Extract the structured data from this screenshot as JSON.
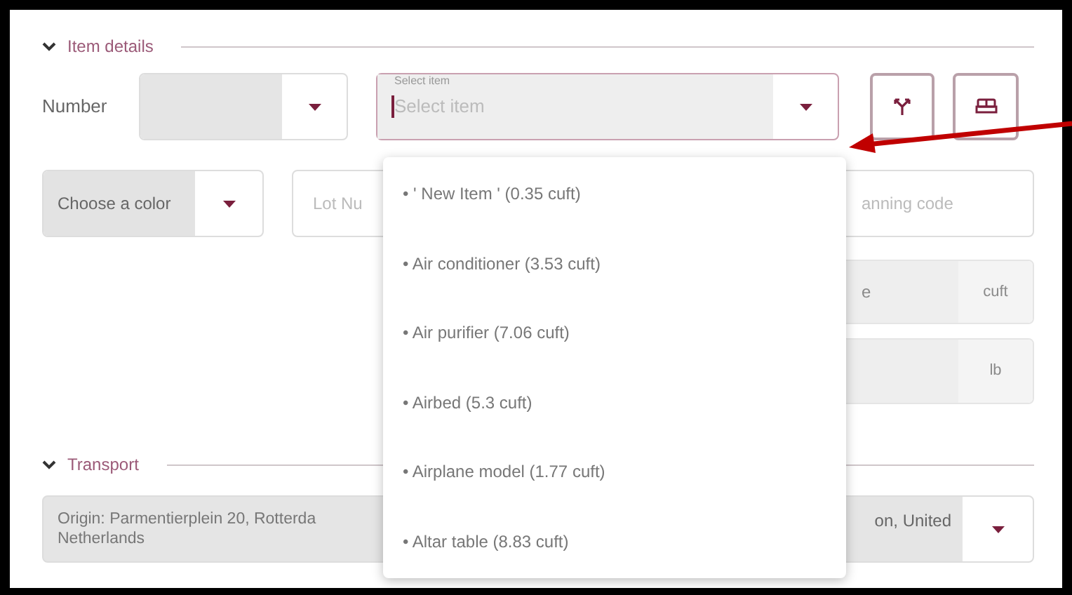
{
  "item_details": {
    "title": "Item details",
    "expanded": true
  },
  "number": {
    "label": "Number"
  },
  "select_item": {
    "label": "Select item",
    "placeholder": "Select item"
  },
  "color_select": {
    "value": "Choose a color"
  },
  "lot_field": {
    "placeholder": "Lot Nu"
  },
  "scanning_field": {
    "placeholder": "anning code"
  },
  "volume_field": {
    "placeholder": "e",
    "unit": "cuft"
  },
  "weight_field": {
    "unit": "lb"
  },
  "transport": {
    "title": "Transport",
    "expanded": true
  },
  "origin": {
    "value": "Origin: Parmentierplein 20, Rotterda\nNetherlands"
  },
  "destination": {
    "value": "on, United"
  },
  "dropdown_items": [
    {
      "label": "• ' New Item ' (0.35 cuft)"
    },
    {
      "label": "• Air conditioner (3.53 cuft)"
    },
    {
      "label": "• Air purifier (7.06 cuft)"
    },
    {
      "label": "• Airbed (5.3 cuft)"
    },
    {
      "label": "• Airplane model (1.77 cuft)"
    },
    {
      "label": "• Altar table (8.83 cuft)"
    }
  ]
}
